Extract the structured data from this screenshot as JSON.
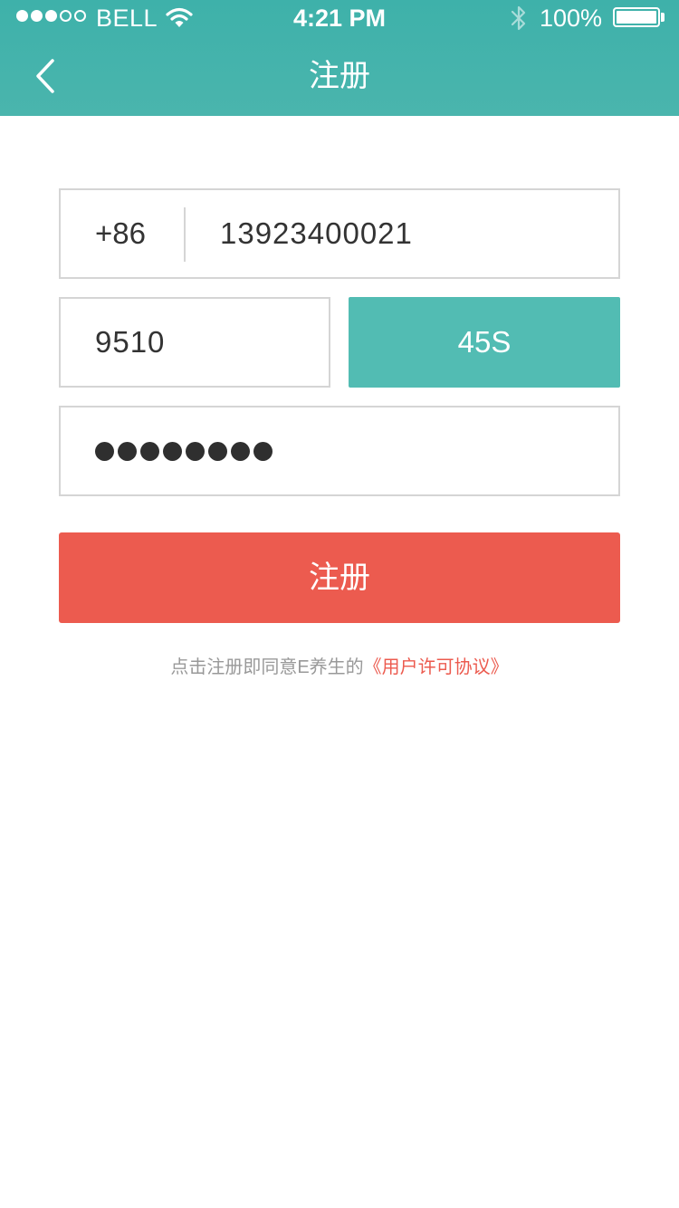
{
  "status_bar": {
    "carrier": "BELL",
    "signal_bars_filled": 3,
    "signal_bars_total": 5,
    "time": "4:21 PM",
    "battery_percent": "100%",
    "battery_level": 1.0
  },
  "nav": {
    "title": "注册",
    "back_icon": "chevron-left-icon"
  },
  "form": {
    "country_code": "+86",
    "phone_value": "13923400021",
    "verification_code_value": "9510",
    "send_code_label": "45S",
    "password_mask_count": 8,
    "register_label": "注册"
  },
  "agreement": {
    "prefix": "点击注册即同意E养生的",
    "link": "《用户许可协议》"
  },
  "colors": {
    "header": "#45b3ac",
    "teal_button": "#52bcb3",
    "register_button": "#ec5b4f",
    "link": "#ec5b4f",
    "muted_text": "#999999",
    "field_border": "#d5d5d5"
  }
}
